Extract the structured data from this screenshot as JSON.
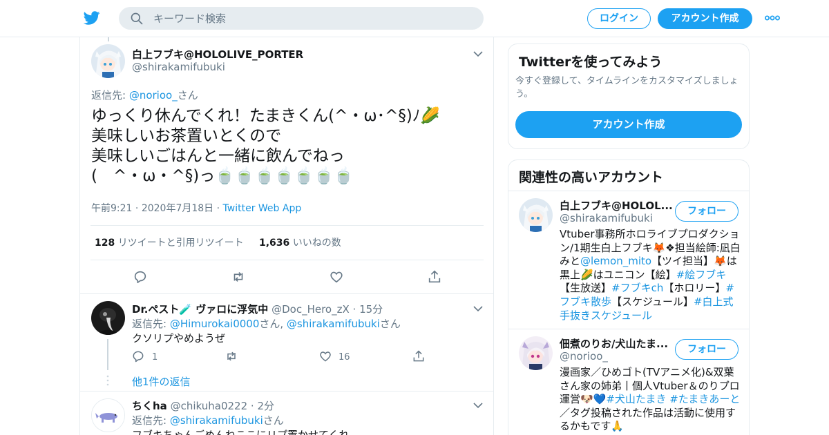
{
  "header": {
    "search_placeholder": "キーワード検索",
    "login_label": "ログイン",
    "signup_label": "アカウント作成"
  },
  "main_tweet": {
    "display_name": "白上フブキ@HOLOLIVE_PORTER",
    "handle": "@shirakamifubuki",
    "replying_prefix": "返信先: ",
    "replying_to": "@norioo_",
    "replying_suffix": "さん",
    "text_lines": [
      "ゆっくり休んでくれ！たまきくん(^・ω･^§)ﾉ🌽",
      "美味しいお茶置いとくので",
      "美味しいごはんと一緒に飲んでねっ",
      "(　^・ω・^§)っ🍵🍵🍵🍵🍵🍵🍵"
    ],
    "time": "午前9:21",
    "date": "2020年7月18日",
    "source": "Twitter Web App",
    "retweet_count": "128",
    "retweet_label": "リツイートと引用リツイート",
    "like_count": "1,636",
    "like_label": "いいねの数"
  },
  "replies": [
    {
      "display_name": "Dr.ペスト🧪 ヴァロに浮気中",
      "handle": "@Doc_Hero_zX",
      "time": "15分",
      "replying_prefix": "返信先: ",
      "replying_to_1": "@Himurokai0000",
      "replying_mid": "さん, ",
      "replying_to_2": "@shirakamifubuki",
      "replying_suffix": "さん",
      "text": "クソリプやめようぜ",
      "reply_count": "1",
      "like_count": "16",
      "more_replies": "他1件の返信"
    },
    {
      "display_name": "ちくha",
      "handle": "@chikuha0222",
      "time": "2分",
      "replying_prefix": "返信先: ",
      "replying_to": "@shirakamifubuki",
      "replying_suffix": "さん",
      "text": "フブキちゃんごめんねここにリプ置かせてくれ"
    }
  ],
  "signup_card": {
    "title": "Twitterを使ってみよう",
    "subtitle": "今すぐ登録して、タイムラインをカスタマイズしましょう。",
    "button": "アカウント作成"
  },
  "related_card": {
    "title": "関連性の高いアカウント",
    "follow_label": "フォロー",
    "accounts": [
      {
        "name": "白上フブキ@HOLOL...",
        "handle": "@shirakamifubuki",
        "bio": [
          {
            "t": "Vtuber事務所ホロライブプロダクション/1期生白上フブキ🦊❖担当絵師:凪白みと",
            "link": false
          },
          {
            "t": "@lemon_mito",
            "link": true
          },
          {
            "t": "【ツイ担当】🦊は黒上🌽はユニコン【絵】",
            "link": false
          },
          {
            "t": "#絵フブキ",
            "link": true
          },
          {
            "t": "【生放送】",
            "link": false
          },
          {
            "t": "#フブキch",
            "link": true
          },
          {
            "t": "【ホロリー】",
            "link": false
          },
          {
            "t": "#フブキ散歩",
            "link": true
          },
          {
            "t": "【スケジュール】",
            "link": false
          },
          {
            "t": "#白上式手抜きスケジュール",
            "link": true
          }
        ]
      },
      {
        "name": "佃煮のりお/犬山たま...",
        "handle": "@norioo_",
        "bio": [
          {
            "t": "漫画家／ひめゴト(TVアニメ化)&双葉さん家の姉弟丨個人Vtuber＆のりプロ運営🐶💙",
            "link": false
          },
          {
            "t": "#犬山たまき",
            "link": true
          },
          {
            "t": " ",
            "link": false
          },
          {
            "t": "#たまきあーと",
            "link": true
          },
          {
            "t": "／タグ投稿された作品は活動に使用するかもです🙏",
            "link": false
          }
        ]
      }
    ]
  },
  "colors": {
    "accent": "#1da1f2",
    "link": "#1b95e0",
    "secondary_text": "#657786",
    "border": "#e6ecf0"
  },
  "icons": [
    "twitter-bird-icon",
    "search-icon",
    "more-icon",
    "chevron-down-icon",
    "reply-icon",
    "retweet-icon",
    "like-icon",
    "share-icon"
  ]
}
